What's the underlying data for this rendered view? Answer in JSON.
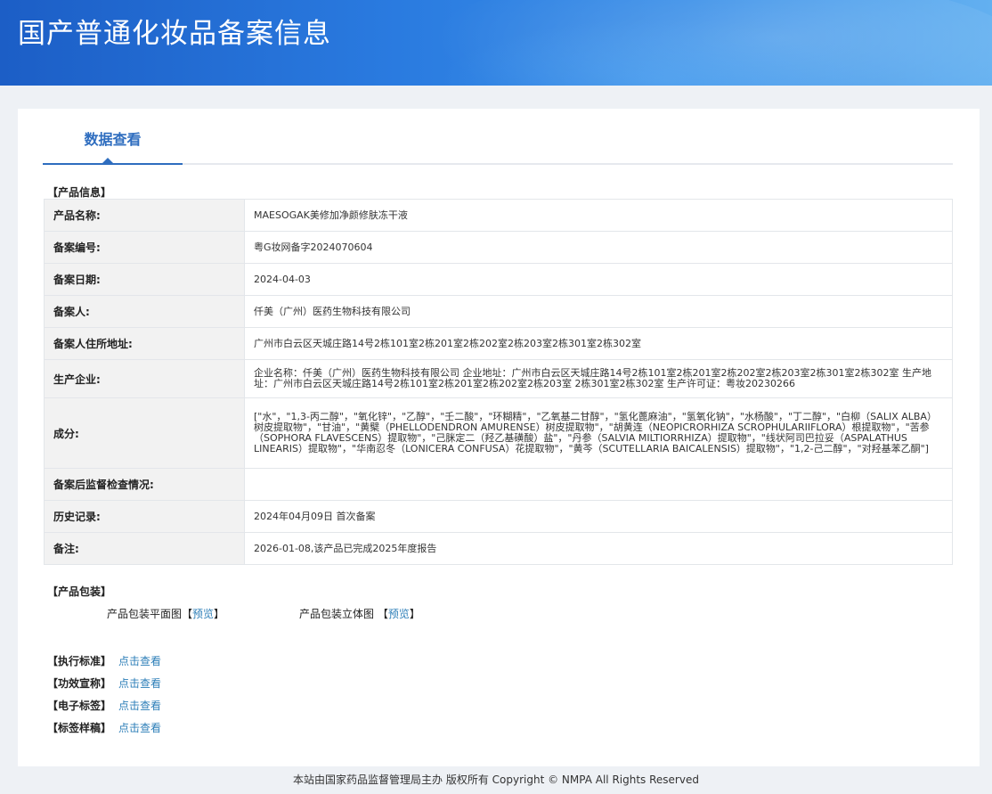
{
  "header": {
    "title": "国产普通化妆品备案信息"
  },
  "tabs": [
    {
      "label": "数据查看"
    }
  ],
  "product_info": {
    "section_label": "【产品信息】",
    "rows": [
      {
        "key": "产品名称:",
        "value": "MAESOGAK美修加净颜修肤冻干液"
      },
      {
        "key": "备案编号:",
        "value": "粤G妆网备字2024070604"
      },
      {
        "key": "备案日期:",
        "value": "2024-04-03"
      },
      {
        "key": "备案人:",
        "value": "仟美（广州）医药生物科技有限公司"
      },
      {
        "key": "备案人住所地址:",
        "value": "广州市白云区天城庄路14号2栋101室2栋201室2栋202室2栋203室2栋301室2栋302室"
      },
      {
        "key": "生产企业:",
        "value": "企业名称：仟美（广州）医药生物科技有限公司 企业地址：广州市白云区天城庄路14号2栋101室2栋201室2栋202室2栋203室2栋301室2栋302室 生产地址：广州市白云区天城庄路14号2栋101室2栋201室2栋202室2栋203室 2栋301室2栋302室 生产许可证：粤妆20230266"
      },
      {
        "key": "成分:",
        "value": "[\"水\"，\"1,3-丙二醇\"，\"氧化锌\"，\"乙醇\"，\"壬二酸\"，\"环糊精\"，\"乙氧基二甘醇\"，\"氢化蓖麻油\"，\"氢氧化钠\"，\"水杨酸\"，\"丁二醇\"，\"白柳（SALIX ALBA）树皮提取物\"，\"甘油\"，\"黄檗（PHELLODENDRON AMURENSE）树皮提取物\"，\"胡黄连（NEOPICRORHIZA SCROPHULARIIFLORA）根提取物\"，\"苦参（SOPHORA FLAVESCENS）提取物\"，\"己脒定二（羟乙基磺酸）盐\"，\"丹参（SALVIA MILTIORRHIZA）提取物\"，\"线状阿司巴拉妥（ASPALATHUS LINEARIS）提取物\"，\"华南忍冬（LONICERA CONFUSA）花提取物\"，\"黄芩（SCUTELLARIA BAICALENSIS）提取物\"，\"1,2-己二醇\"，\"对羟基苯乙酮\"]"
      },
      {
        "key": "备案后监督检查情况:",
        "value": ""
      },
      {
        "key": "历史记录:",
        "value": "2024年04月09日 首次备案"
      },
      {
        "key": "备注:",
        "value": "2026-01-08,该产品已完成2025年度报告"
      }
    ]
  },
  "packaging": {
    "section_label": "【产品包装】",
    "flat": {
      "label": "产品包装平面图",
      "open": "【",
      "link": "预览",
      "close": "】"
    },
    "stereo": {
      "label": "产品包装立体图 ",
      "open": "【",
      "link": "预览",
      "close": "】"
    }
  },
  "standards": [
    {
      "label": "【执行标准】",
      "link": "点击查看"
    },
    {
      "label": "【功效宣称】",
      "link": "点击查看"
    },
    {
      "label": "【电子标签】",
      "link": "点击查看"
    },
    {
      "label": "【标签样稿】",
      "link": "点击查看"
    }
  ],
  "footer": {
    "text": "本站由国家药品监督管理局主办 版权所有 Copyright © NMPA All Rights Reserved"
  },
  "colors": {
    "header": "#2a7be0",
    "accent": "#2e6dbf",
    "link": "#2e7fb8"
  }
}
